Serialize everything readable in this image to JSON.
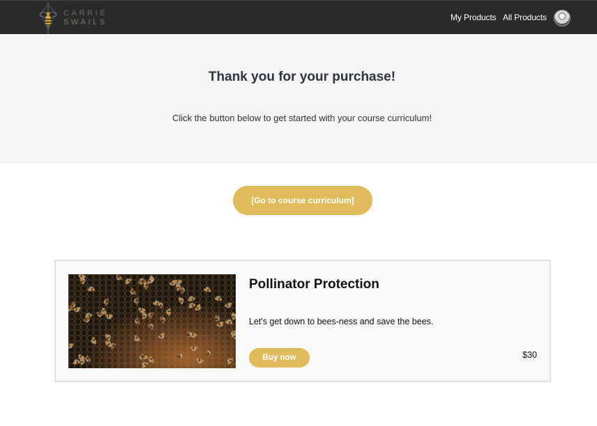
{
  "header": {
    "logo": {
      "line1": "CARRIE",
      "line2": "SWAILS",
      "icon": "bee-icon"
    },
    "nav": [
      {
        "label": "My Products"
      },
      {
        "label": "All Products"
      }
    ],
    "avatar_icon": "user-avatar"
  },
  "hero": {
    "title": "Thank you for your purchase!",
    "subtitle": "Click the button below to get started with your course curriculum!"
  },
  "cta": {
    "label": "[Go to course curriculum]"
  },
  "product": {
    "title": "Pollinator Protection",
    "description": "Let's get down to bees-ness and save the bees.",
    "buy_label": "Buy now",
    "price": "$30",
    "image_icon": "honeybee-photo"
  },
  "colors": {
    "accent": "#e0bb5a",
    "topbar": "#2a2a2a",
    "hero_bg": "#f4f4f5"
  }
}
